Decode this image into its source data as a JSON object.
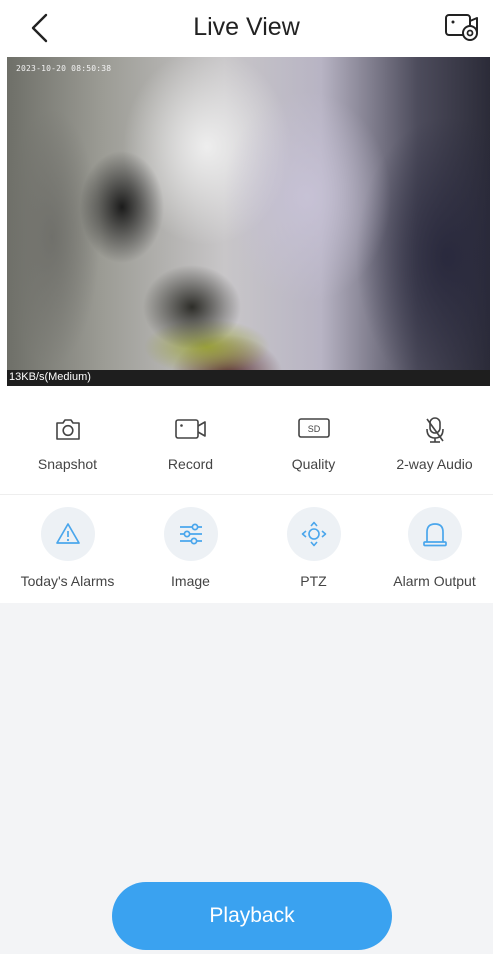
{
  "header": {
    "title": "Live View",
    "back_icon": "chevron-left-icon",
    "settings_icon": "camera-settings-icon"
  },
  "video": {
    "osd_timestamp": "2023-10-20 08:50:38",
    "bitrate": "13KB/s(Medium)"
  },
  "controls_primary": [
    {
      "label": "Snapshot",
      "icon": "camera-icon"
    },
    {
      "label": "Record",
      "icon": "video-record-icon"
    },
    {
      "label": "Quality",
      "icon": "sd-quality-icon"
    },
    {
      "label": "2-way Audio",
      "icon": "microphone-muted-icon"
    }
  ],
  "controls_secondary": [
    {
      "label": "Today's Alarms",
      "icon": "warning-icon"
    },
    {
      "label": "Image",
      "icon": "sliders-icon"
    },
    {
      "label": "PTZ",
      "icon": "ptz-directions-icon"
    },
    {
      "label": "Alarm Output",
      "icon": "siren-icon"
    }
  ],
  "playback_label": "Playback",
  "colors": {
    "accent": "#3aa2f0",
    "icon_blue": "#4aa6ec",
    "icon_circle_bg": "#edf1f5",
    "lower_bg": "#f3f4f6"
  }
}
